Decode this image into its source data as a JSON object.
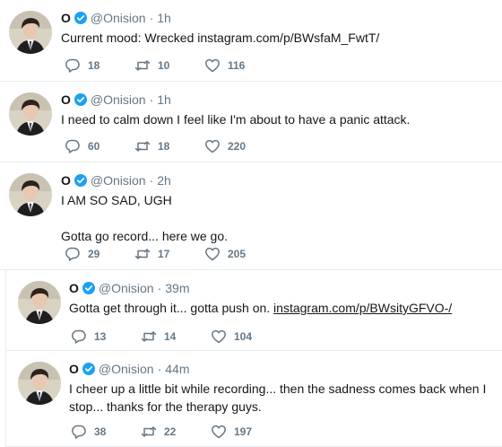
{
  "colors": {
    "text": "#14171a",
    "muted": "#657786",
    "verified": "#1da1f2",
    "divider": "#e6ecf0"
  },
  "icons": {
    "reply": "reply-icon",
    "retweet": "retweet-icon",
    "like": "heart-icon",
    "verified": "verified-badge-icon"
  },
  "tweets": [
    {
      "name": "O",
      "handle": "@Onision",
      "time": "1h",
      "text": "Current mood: Wrecked ",
      "link": "instagram.com/p/BWsfaM_FwtT/",
      "replies": "18",
      "retweets": "10",
      "likes": "116"
    },
    {
      "name": "O",
      "handle": "@Onision",
      "time": "1h",
      "text": "I need to calm down I feel like I'm about to have a panic attack.",
      "replies": "60",
      "retweets": "18",
      "likes": "220"
    },
    {
      "name": "O",
      "handle": "@Onision",
      "time": "2h",
      "text": "I AM SO SAD, UGH\n\nGotta go record... here we go.",
      "replies": "29",
      "retweets": "17",
      "likes": "205"
    },
    {
      "name": "O",
      "handle": "@Onision",
      "time": "39m",
      "text": "Gotta get through it... gotta push on. ",
      "link": "instagram.com/p/BWsityGFVO-/",
      "replies": "13",
      "retweets": "14",
      "likes": "104"
    },
    {
      "name": "O",
      "handle": "@Onision",
      "time": "44m",
      "text": "I cheer up a little bit while recording... then the sadness comes back when I stop... thanks for the therapy guys.",
      "replies": "38",
      "retweets": "22",
      "likes": "197"
    }
  ]
}
